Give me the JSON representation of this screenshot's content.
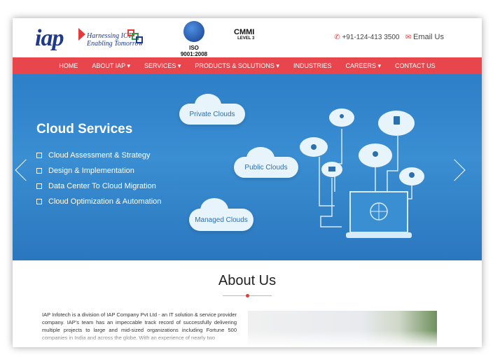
{
  "header": {
    "logo_text": "iap",
    "logo_tagline_1": "Harnessing ICT",
    "logo_tagline_2": "Enabling Tomorrow",
    "iso_label": "ISO 9001:2008",
    "cmmi_label": "CMMI",
    "cmmi_level": "LEVEL 3",
    "phone": "+91-124-413 3500",
    "email_label": "Email Us"
  },
  "nav": {
    "items": [
      "HOME",
      "ABOUT IAP ▾",
      "SERVICES ▾",
      "PRODUCTS & SOLUTIONS ▾",
      "INDUSTRIES",
      "CAREERS ▾",
      "CONTACT US"
    ]
  },
  "hero": {
    "title": "Cloud Services",
    "bullets": [
      "Cloud Assessment & Strategy",
      "Design & Implementation",
      "Data Center To Cloud Migration",
      "Cloud Optimization & Automation"
    ],
    "clouds": [
      "Private Clouds",
      "Public Clouds",
      "Managed Clouds"
    ]
  },
  "about": {
    "heading": "About Us",
    "text": "IAP Infotech is a division of IAP Company Pvt Ltd - an IT solution & service provider company. IAP's team has an impeccable track record of successfully delivering multiple projects to large and mid-sized organizations including Fortune 500 companies in India and across the globe. With an experience of nearly two"
  },
  "colors": {
    "nav_bg": "#e8454d",
    "hero_bg": "#2d7fc7",
    "brand_blue": "#1f3a8a"
  }
}
